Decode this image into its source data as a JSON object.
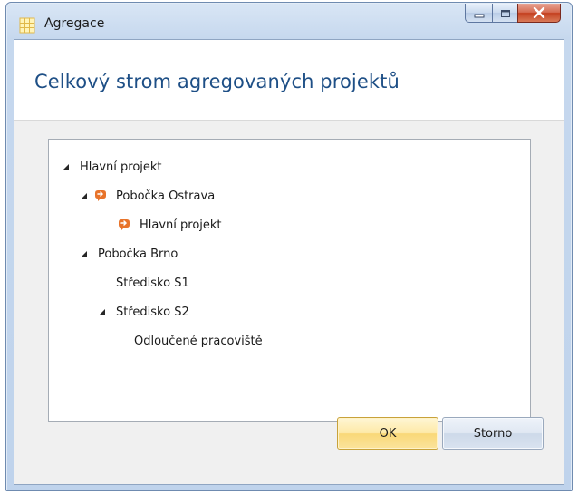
{
  "window": {
    "title": "Agregace"
  },
  "header": {
    "title": "Celkový strom agregovaných projektů"
  },
  "tree": {
    "items": [
      {
        "label": "Hlavní projekt",
        "level": 0,
        "expanded": true,
        "icon": ""
      },
      {
        "label": "Pobočka Ostrava",
        "level": 1,
        "expanded": true,
        "icon": "orange-link-icon"
      },
      {
        "label": "Hlavní projekt",
        "level": 2,
        "expanded": null,
        "icon": "orange-link-icon"
      },
      {
        "label": "Pobočka Brno",
        "level": 1,
        "expanded": true,
        "icon": ""
      },
      {
        "label": "Středisko S1",
        "level": 2,
        "expanded": null,
        "icon": ""
      },
      {
        "label": "Středisko S2",
        "level": 2,
        "expanded": true,
        "icon": ""
      },
      {
        "label": "Odloučené pracoviště",
        "level": 3,
        "expanded": null,
        "icon": ""
      }
    ]
  },
  "buttons": {
    "ok_label": "OK",
    "cancel_label": "Storno"
  },
  "colors": {
    "header_text": "#1e4f86",
    "ok_button": "#fde9a6",
    "link_icon": "#e8732a"
  }
}
